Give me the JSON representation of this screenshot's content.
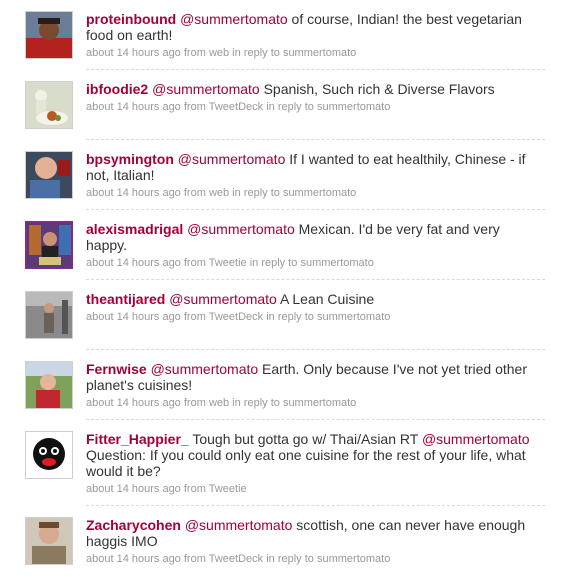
{
  "tweets": [
    {
      "user": "proteinbound",
      "mention": "@summertomato",
      "text": " of course, Indian! the best vegetarian food on earth!",
      "time": "about 14 hours ago",
      "from_word": " from ",
      "source": "web",
      "reply_word": " in reply to ",
      "reply_to": "summertomato"
    },
    {
      "user": "ibfoodie2",
      "mention": "@summertomato",
      "text": " Spanish, Such rich & Diverse Flavors",
      "time": "about 14 hours ago",
      "from_word": " from ",
      "source": "TweetDeck",
      "reply_word": " in reply to ",
      "reply_to": "summertomato"
    },
    {
      "user": "bpsymington",
      "mention": "@summertomato",
      "text": " If I wanted to eat healthily, Chinese - if not, Italian!",
      "time": "about 14 hours ago",
      "from_word": " from ",
      "source": "web",
      "reply_word": " in reply to ",
      "reply_to": "summertomato"
    },
    {
      "user": "alexismadrigal",
      "mention": "@summertomato",
      "text": " Mexican. I'd be very fat and very happy.",
      "time": "about 14 hours ago",
      "from_word": " from ",
      "source": "Tweetie",
      "reply_word": " in reply to ",
      "reply_to": "summertomato"
    },
    {
      "user": "theantijared",
      "mention": "@summertomato",
      "text": " A Lean Cuisine",
      "time": "about 14 hours ago",
      "from_word": " from ",
      "source": "TweetDeck",
      "reply_word": " in reply to ",
      "reply_to": "summertomato"
    },
    {
      "user": "Fernwise",
      "mention": "@summertomato",
      "text": " Earth. Only because I've not yet tried other planet's cuisines!",
      "time": "about 14 hours ago",
      "from_word": " from ",
      "source": "web",
      "reply_word": " in reply to ",
      "reply_to": "summertomato"
    },
    {
      "user": "Fitter_Happier_",
      "pre_text": " Tough but gotta go w/ Thai/Asian RT ",
      "mention": "@summertomato",
      "text": " Question: If you could only eat one cuisine for the rest of your life, what would it be?",
      "time": "about 14 hours ago",
      "from_word": " from ",
      "source": "Tweetie"
    },
    {
      "user": "Zacharycohen",
      "mention": "@summertomato",
      "text": " scottish, one can never have enough haggis IMO",
      "time": "about 14 hours ago",
      "from_word": " from ",
      "source": "TweetDeck",
      "reply_word": " in reply to ",
      "reply_to": "summertomato"
    }
  ]
}
